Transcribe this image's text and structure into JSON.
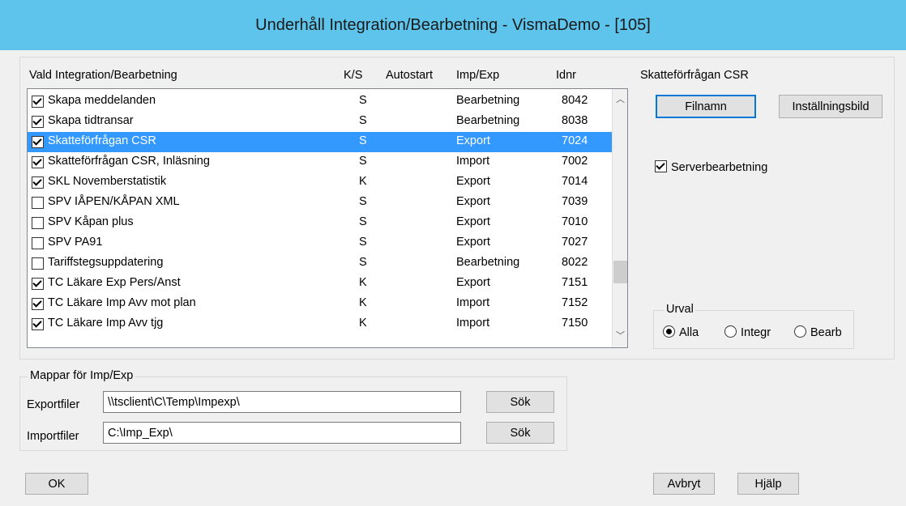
{
  "window": {
    "title": "Underhåll Integration/Bearbetning - VismaDemo - [105]"
  },
  "columns": {
    "name": "Vald Integration/Bearbetning",
    "ks": "K/S",
    "autostart": "Autostart",
    "impexp": "Imp/Exp",
    "idnr": "Idnr"
  },
  "rows": [
    {
      "checked": true,
      "name": "Skapa meddelanden",
      "ks": "S",
      "autostart": "",
      "impexp": "Bearbetning",
      "idnr": "8042",
      "selected": false
    },
    {
      "checked": true,
      "name": "Skapa tidtransar",
      "ks": "S",
      "autostart": "",
      "impexp": "Bearbetning",
      "idnr": "8038",
      "selected": false
    },
    {
      "checked": true,
      "name": "Skatteförfrågan CSR",
      "ks": "S",
      "autostart": "",
      "impexp": "Export",
      "idnr": "7024",
      "selected": true
    },
    {
      "checked": true,
      "name": "Skatteförfrågan CSR, Inläsning",
      "ks": "S",
      "autostart": "",
      "impexp": "Import",
      "idnr": "7002",
      "selected": false
    },
    {
      "checked": true,
      "name": "SKL Novemberstatistik",
      "ks": "K",
      "autostart": "",
      "impexp": "Export",
      "idnr": "7014",
      "selected": false
    },
    {
      "checked": false,
      "name": "SPV IÅPEN/KÅPAN XML",
      "ks": "S",
      "autostart": "",
      "impexp": "Export",
      "idnr": "7039",
      "selected": false
    },
    {
      "checked": false,
      "name": "SPV Kåpan plus",
      "ks": "S",
      "autostart": "",
      "impexp": "Export",
      "idnr": "7010",
      "selected": false
    },
    {
      "checked": false,
      "name": "SPV PA91",
      "ks": "S",
      "autostart": "",
      "impexp": "Export",
      "idnr": "7027",
      "selected": false
    },
    {
      "checked": false,
      "name": "Tariffstegsuppdatering",
      "ks": "S",
      "autostart": "",
      "impexp": "Bearbetning",
      "idnr": "8022",
      "selected": false
    },
    {
      "checked": true,
      "name": "TC Läkare Exp Pers/Anst",
      "ks": "K",
      "autostart": "",
      "impexp": "Export",
      "idnr": "7151",
      "selected": false
    },
    {
      "checked": true,
      "name": "TC Läkare Imp Avv mot plan",
      "ks": "K",
      "autostart": "",
      "impexp": "Import",
      "idnr": "7152",
      "selected": false
    },
    {
      "checked": true,
      "name": "TC Läkare Imp Avv tjg",
      "ks": "K",
      "autostart": "",
      "impexp": "Import",
      "idnr": "7150",
      "selected": false
    }
  ],
  "right_panel": {
    "title": "Skatteförfrågan CSR",
    "filnamn_label": "Filnamn",
    "installningsbild_label": "Inställningsbild",
    "serverbearbetning_label": "Serverbearbetning",
    "serverbearbetning_checked": true,
    "urval_label": "Urval",
    "urval_options": [
      "Alla",
      "Integr",
      "Bearb"
    ],
    "urval_selected": "Alla"
  },
  "folders": {
    "group_label": "Mappar för Imp/Exp",
    "export_label": "Exportfiler",
    "export_value": "\\\\tsclient\\C\\Temp\\Impexp\\",
    "import_label": "Importfiler",
    "import_value": "C:\\Imp_Exp\\",
    "browse_label": "Sök"
  },
  "buttons": {
    "ok": "OK",
    "cancel": "Avbryt",
    "help": "Hjälp"
  },
  "colors": {
    "titlebar": "#5ec4ec",
    "selection": "#3399ff"
  }
}
